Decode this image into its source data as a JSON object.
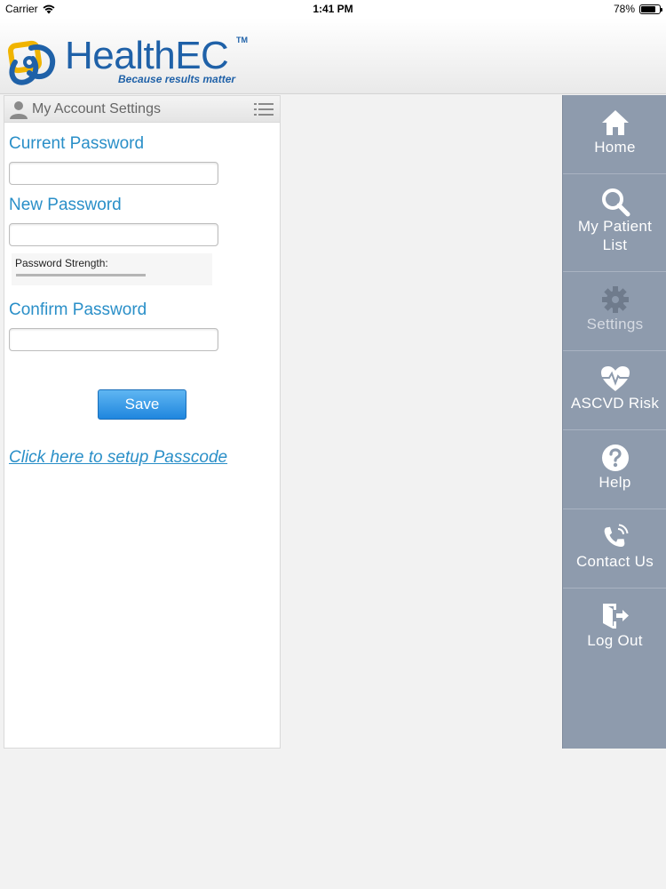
{
  "status_bar": {
    "carrier": "Carrier",
    "time": "1:41 PM",
    "battery": "78%",
    "battery_level": 0.78
  },
  "header": {
    "logo_text": "HealthEC",
    "logo_tm": "TM",
    "tagline": "Because results matter"
  },
  "account_panel": {
    "title": "My Account Settings",
    "current_password_label": "Current Password",
    "current_password_value": "",
    "new_password_label": "New Password",
    "new_password_value": "",
    "password_strength_label": "Password Strength:",
    "confirm_password_label": "Confirm Password",
    "confirm_password_value": "",
    "save_label": "Save",
    "passcode_link": "Click here to setup Passcode"
  },
  "side_nav": {
    "items": [
      {
        "label": "Home",
        "icon": "home-icon"
      },
      {
        "label": "My Patient List",
        "icon": "search-icon"
      },
      {
        "label": "Settings",
        "icon": "gear-icon"
      },
      {
        "label": "ASCVD Risk",
        "icon": "heart-pulse-icon"
      },
      {
        "label": "Help",
        "icon": "help-icon"
      },
      {
        "label": "Contact Us",
        "icon": "phone-icon"
      },
      {
        "label": "Log Out",
        "icon": "logout-icon"
      }
    ]
  },
  "colors": {
    "accent": "#2a8fc8",
    "brand": "#1f61a8",
    "nav_bg": "#8e9bad",
    "button": "#1f86de"
  }
}
